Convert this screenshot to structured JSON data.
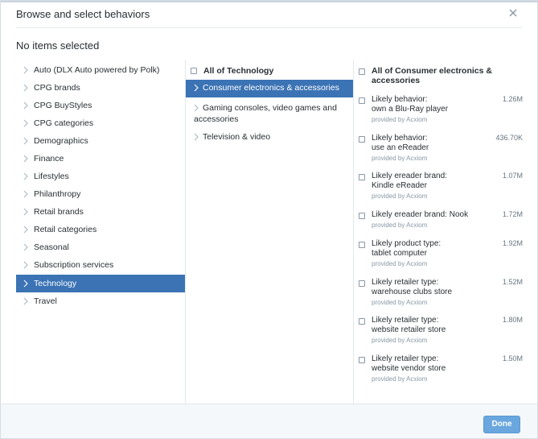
{
  "dialog": {
    "title": "Browse and select behaviors",
    "selection_status": "No items selected",
    "done_label": "Done"
  },
  "categories": [
    {
      "label": "Auto (DLX Auto powered by Polk)",
      "active": false
    },
    {
      "label": "CPG brands",
      "active": false
    },
    {
      "label": "CPG BuyStyles",
      "active": false
    },
    {
      "label": "CPG categories",
      "active": false
    },
    {
      "label": "Demographics",
      "active": false
    },
    {
      "label": "Finance",
      "active": false
    },
    {
      "label": "Lifestyles",
      "active": false
    },
    {
      "label": "Philanthropy",
      "active": false
    },
    {
      "label": "Retail brands",
      "active": false
    },
    {
      "label": "Retail categories",
      "active": false
    },
    {
      "label": "Seasonal",
      "active": false
    },
    {
      "label": "Subscription services",
      "active": false
    },
    {
      "label": "Technology",
      "active": true
    },
    {
      "label": "Travel",
      "active": false
    }
  ],
  "subcategories": {
    "all_label": "All of Technology",
    "items": [
      {
        "label": "Consumer electronics & accessories",
        "active": true
      },
      {
        "label_line1": "Gaming consoles, video games and",
        "label_line2": "accessories",
        "active": false
      },
      {
        "label": "Television & video",
        "active": false
      }
    ]
  },
  "behaviors": {
    "all_label": "All of Consumer electronics & accessories",
    "items": [
      {
        "line1": "Likely behavior:",
        "line2": "own a Blu-Ray player",
        "size": "1.26M",
        "provider": "provided by Acxiom"
      },
      {
        "line1": "Likely behavior:",
        "line2": "use an eReader",
        "size": "436.70K",
        "provider": "provided by Acxiom"
      },
      {
        "line1": "Likely ereader brand:",
        "line2": "Kindle eReader",
        "size": "1.07M",
        "provider": "provided by Acxiom"
      },
      {
        "line1": "Likely ereader brand: Nook",
        "line2": "",
        "size": "1.72M",
        "provider": "provided by Acxiom"
      },
      {
        "line1": "Likely product type:",
        "line2": "tablet computer",
        "size": "1.92M",
        "provider": "provided by Acxiom"
      },
      {
        "line1": "Likely retailer type:",
        "line2": "warehouse clubs store",
        "size": "1.52M",
        "provider": "provided by Acxiom"
      },
      {
        "line1": "Likely retailer type:",
        "line2": "website retailer store",
        "size": "1.80M",
        "provider": "provided by Acxiom"
      },
      {
        "line1": "Likely retailer type:",
        "line2": "website vendor store",
        "size": "1.50M",
        "provider": "provided by Acxiom"
      }
    ]
  },
  "icons": {
    "close": "close-icon",
    "chevron": "chevron-right-icon"
  },
  "colors": {
    "active_row": "#3b73b4",
    "done_button": "#6aa7de"
  }
}
